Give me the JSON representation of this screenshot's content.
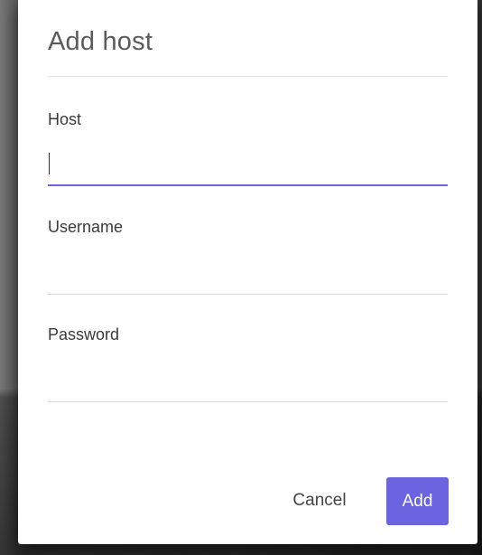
{
  "dialog": {
    "title": "Add host",
    "fields": [
      {
        "label": "Host",
        "value": "",
        "focused": true
      },
      {
        "label": "Username",
        "value": "",
        "focused": false
      },
      {
        "label": "Password",
        "value": "",
        "focused": false
      }
    ],
    "actions": {
      "cancel_label": "Cancel",
      "add_label": "Add"
    }
  },
  "colors": {
    "accent": "#6b63e0",
    "divider": "#d7d7d7",
    "backdrop": "#3d3d3d"
  }
}
